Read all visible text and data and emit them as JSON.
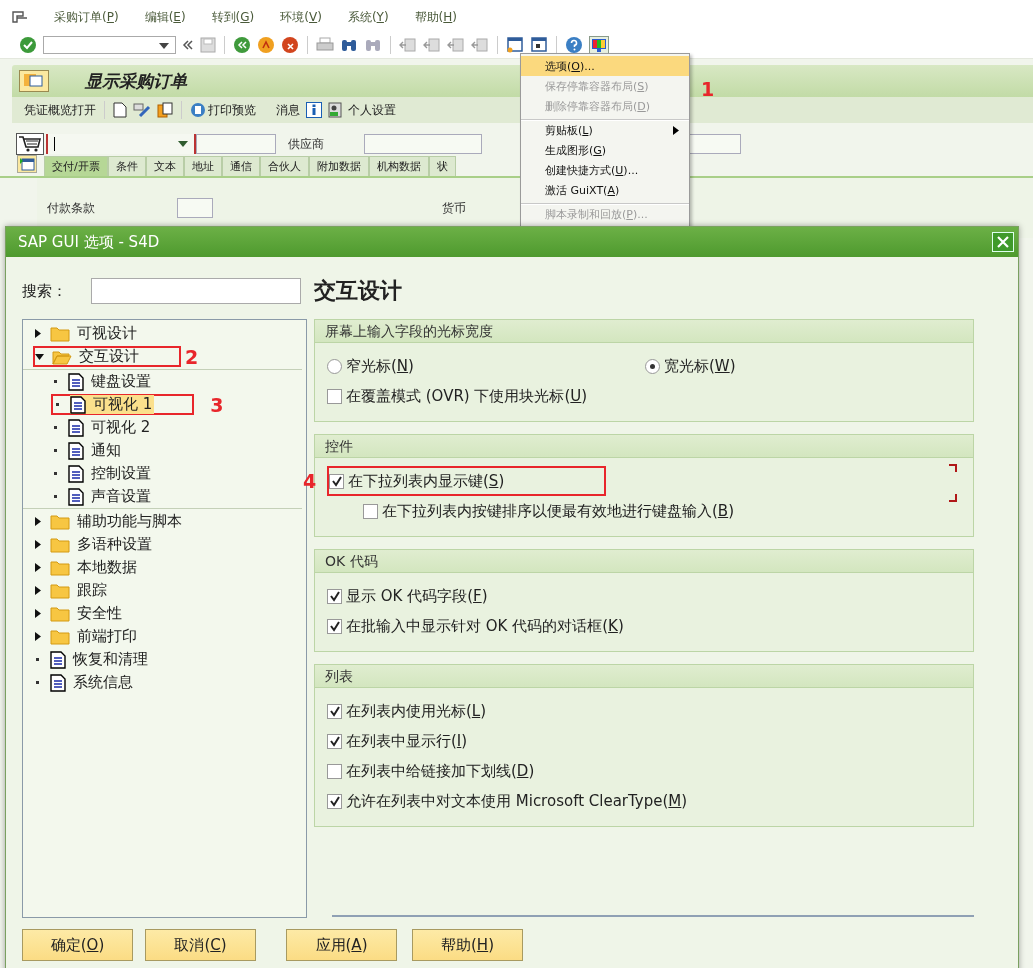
{
  "menubar": [
    {
      "parts": [
        "采购订单(",
        "P",
        ")"
      ]
    },
    {
      "parts": [
        "编辑(",
        "E",
        ")"
      ]
    },
    {
      "parts": [
        "转到(",
        "G",
        ")"
      ]
    },
    {
      "parts": [
        "环境(",
        "V",
        ")"
      ]
    },
    {
      "parts": [
        "系统(",
        "Y",
        ")"
      ]
    },
    {
      "parts": [
        "帮助(",
        "H",
        ")"
      ]
    }
  ],
  "screen": {
    "title": "显示采购订单",
    "app_toolbar": [
      "凭证概览打开",
      "打印预览",
      "消息",
      "个人设置"
    ],
    "vendor_label": "供应商",
    "tabs": [
      {
        "label": "交付/开票",
        "selected": true
      },
      {
        "label": "条件",
        "selected": false
      },
      {
        "label": "文本",
        "selected": false
      },
      {
        "label": "地址",
        "selected": false
      },
      {
        "label": "通信",
        "selected": false
      },
      {
        "label": "合伙人",
        "selected": false
      },
      {
        "label": "附加数据",
        "selected": false
      },
      {
        "label": "机构数据",
        "selected": false
      },
      {
        "label": "状",
        "selected": false
      }
    ],
    "field_labels": [
      "付款条款",
      "货币"
    ]
  },
  "context_menu": {
    "annotation": "1",
    "items": [
      {
        "parts": [
          "选项(",
          "O",
          ")..."
        ],
        "selected": true,
        "disabled": false,
        "separator_before": false,
        "submenu": false
      },
      {
        "parts": [
          "保存停靠容器布局(",
          "S",
          ")"
        ],
        "selected": false,
        "disabled": true,
        "separator_before": false,
        "submenu": false
      },
      {
        "parts": [
          "删除停靠容器布局(",
          "D",
          ")"
        ],
        "selected": false,
        "disabled": true,
        "separator_before": false,
        "submenu": false
      },
      {
        "parts": [
          "剪贴板(",
          "L",
          ")"
        ],
        "selected": false,
        "disabled": false,
        "separator_before": true,
        "submenu": true
      },
      {
        "parts": [
          "生成图形(",
          "G",
          ")"
        ],
        "selected": false,
        "disabled": false,
        "separator_before": false,
        "submenu": false
      },
      {
        "parts": [
          "创建快捷方式(",
          "U",
          ")..."
        ],
        "selected": false,
        "disabled": false,
        "separator_before": false,
        "submenu": false
      },
      {
        "parts": [
          "激活 GuiXT(",
          "A",
          ")"
        ],
        "selected": false,
        "disabled": false,
        "separator_before": false,
        "submenu": false
      },
      {
        "parts": [
          "脚本录制和回放(",
          "P",
          ")..."
        ],
        "selected": false,
        "disabled": true,
        "separator_before": true,
        "submenu": false
      }
    ]
  },
  "dialog": {
    "title": "SAP GUI 选项 - S4D",
    "search_label": "搜索：",
    "tree": [
      {
        "kind": "folder",
        "label": "可视设计",
        "expanded": false,
        "selected": false
      },
      {
        "kind": "folder",
        "label": "交互设计",
        "expanded": true,
        "selected": false,
        "annotation": "2",
        "children": [
          {
            "kind": "page",
            "label": "键盘设置",
            "selected": false
          },
          {
            "kind": "page",
            "label": "可视化 1",
            "selected": true,
            "annotation": "3"
          },
          {
            "kind": "page",
            "label": "可视化 2",
            "selected": false
          },
          {
            "kind": "page",
            "label": "通知",
            "selected": false
          },
          {
            "kind": "page",
            "label": "控制设置",
            "selected": false
          },
          {
            "kind": "page",
            "label": "声音设置",
            "selected": false
          }
        ]
      },
      {
        "kind": "folder",
        "label": "辅助功能与脚本",
        "expanded": false,
        "selected": false
      },
      {
        "kind": "folder",
        "label": "多语种设置",
        "expanded": false,
        "selected": false
      },
      {
        "kind": "folder",
        "label": "本地数据",
        "expanded": false,
        "selected": false
      },
      {
        "kind": "folder",
        "label": "跟踪",
        "expanded": false,
        "selected": false
      },
      {
        "kind": "folder",
        "label": "安全性",
        "expanded": false,
        "selected": false
      },
      {
        "kind": "folder",
        "label": "前端打印",
        "expanded": false,
        "selected": false
      },
      {
        "kind": "page",
        "label": "恢复和清理",
        "selected": false
      },
      {
        "kind": "page",
        "label": "系统信息",
        "selected": false
      }
    ],
    "page_title": "交互设计",
    "groups": [
      {
        "title": "屏幕上输入字段的光标宽度",
        "options": [
          {
            "kind": "radio",
            "parts": [
              "窄光标(",
              "N",
              ")"
            ],
            "checked": false
          },
          {
            "kind": "radio",
            "parts": [
              "宽光标(",
              "W",
              ")"
            ],
            "checked": true
          },
          {
            "kind": "checkbox",
            "parts": [
              "在覆盖模式 (OVR) 下使用块光标(",
              "U",
              ")"
            ],
            "checked": false
          }
        ]
      },
      {
        "title": "控件",
        "options": [
          {
            "kind": "checkbox",
            "parts": [
              "在下拉列表内显示键(",
              "S",
              ")"
            ],
            "checked": true,
            "focused": true,
            "annotation": "4"
          },
          {
            "kind": "subcheckbox",
            "parts": [
              "在下拉列表内按键排序以便最有效地进行键盘输入(",
              "B",
              ")"
            ],
            "checked": false,
            "focused": false
          }
        ]
      },
      {
        "title": "OK 代码",
        "options": [
          {
            "kind": "checkbox",
            "parts": [
              "显示 OK 代码字段(",
              "F",
              ")"
            ],
            "checked": true
          },
          {
            "kind": "checkbox",
            "parts": [
              "在批输入中显示针对 OK 代码的对话框(",
              "K",
              ")"
            ],
            "checked": true
          }
        ]
      },
      {
        "title": "列表",
        "options": [
          {
            "kind": "checkbox",
            "parts": [
              "在列表内使用光标(",
              "L",
              ")"
            ],
            "checked": true
          },
          {
            "kind": "checkbox",
            "parts": [
              "在列表中显示行(",
              "I",
              ")"
            ],
            "checked": true
          },
          {
            "kind": "checkbox",
            "parts": [
              "在列表中给链接加下划线(",
              "D",
              ")"
            ],
            "checked": false
          },
          {
            "kind": "checkbox",
            "parts": [
              "允许在列表中对文本使用 Microsoft ClearType(",
              "M",
              ")"
            ],
            "checked": true
          }
        ]
      }
    ],
    "buttons": [
      {
        "parts": [
          "确定(",
          "O",
          ")"
        ]
      },
      {
        "parts": [
          "取消(",
          "C",
          ")"
        ]
      },
      {
        "parts": [
          "应用(",
          "A",
          ")"
        ]
      },
      {
        "parts": [
          "帮助(",
          "H",
          ")"
        ]
      }
    ]
  }
}
